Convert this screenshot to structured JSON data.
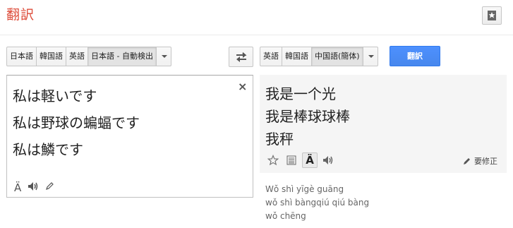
{
  "header": {
    "title": "翻訳"
  },
  "source_langs": [
    {
      "label": "日本語",
      "selected": false
    },
    {
      "label": "韓国語",
      "selected": false
    },
    {
      "label": "英語",
      "selected": false
    },
    {
      "label": "日本語 - 自動検出",
      "selected": true
    }
  ],
  "target_langs": [
    {
      "label": "英語",
      "selected": false
    },
    {
      "label": "韓国語",
      "selected": false
    },
    {
      "label": "中国語(簡体)",
      "selected": true
    }
  ],
  "translate_button": "翻訳",
  "source": {
    "lines": [
      "私は軽いです",
      "私は野球の蝙蝠です",
      "私は鱗です"
    ],
    "clear_icon": "×"
  },
  "result": {
    "lines": [
      "我是一个光",
      "我是棒球球棒",
      "我秤"
    ],
    "suggest_edit": "要修正"
  },
  "romanization": [
    "Wǒ shì yīgè guāng",
    "wǒ shì bàngqiú qiú bàng",
    "wǒ chēng"
  ],
  "icons": {
    "star": "star-icon",
    "swap": "swap-icon",
    "romanize": "Ä",
    "speaker": "speaker-icon",
    "pencil": "pencil-icon",
    "list": "list-icon"
  },
  "colors": {
    "title": "#dd4b39",
    "primary_button": "#4d90fe",
    "result_bg": "#f5f5f5"
  }
}
